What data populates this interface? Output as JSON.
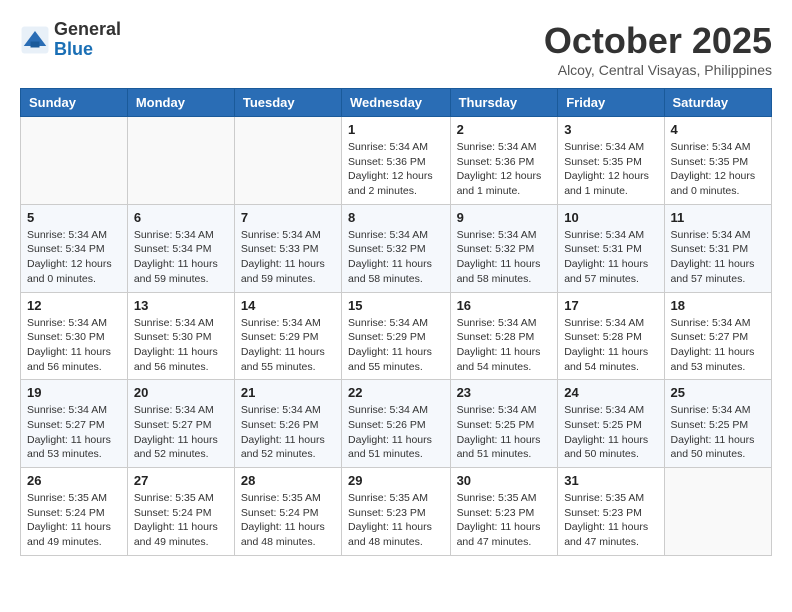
{
  "header": {
    "logo_line1": "General",
    "logo_line2": "Blue",
    "month": "October 2025",
    "location": "Alcoy, Central Visayas, Philippines"
  },
  "weekdays": [
    "Sunday",
    "Monday",
    "Tuesday",
    "Wednesday",
    "Thursday",
    "Friday",
    "Saturday"
  ],
  "weeks": [
    [
      {
        "day": "",
        "info": ""
      },
      {
        "day": "",
        "info": ""
      },
      {
        "day": "",
        "info": ""
      },
      {
        "day": "1",
        "info": "Sunrise: 5:34 AM\nSunset: 5:36 PM\nDaylight: 12 hours\nand 2 minutes."
      },
      {
        "day": "2",
        "info": "Sunrise: 5:34 AM\nSunset: 5:36 PM\nDaylight: 12 hours\nand 1 minute."
      },
      {
        "day": "3",
        "info": "Sunrise: 5:34 AM\nSunset: 5:35 PM\nDaylight: 12 hours\nand 1 minute."
      },
      {
        "day": "4",
        "info": "Sunrise: 5:34 AM\nSunset: 5:35 PM\nDaylight: 12 hours\nand 0 minutes."
      }
    ],
    [
      {
        "day": "5",
        "info": "Sunrise: 5:34 AM\nSunset: 5:34 PM\nDaylight: 12 hours\nand 0 minutes."
      },
      {
        "day": "6",
        "info": "Sunrise: 5:34 AM\nSunset: 5:34 PM\nDaylight: 11 hours\nand 59 minutes."
      },
      {
        "day": "7",
        "info": "Sunrise: 5:34 AM\nSunset: 5:33 PM\nDaylight: 11 hours\nand 59 minutes."
      },
      {
        "day": "8",
        "info": "Sunrise: 5:34 AM\nSunset: 5:32 PM\nDaylight: 11 hours\nand 58 minutes."
      },
      {
        "day": "9",
        "info": "Sunrise: 5:34 AM\nSunset: 5:32 PM\nDaylight: 11 hours\nand 58 minutes."
      },
      {
        "day": "10",
        "info": "Sunrise: 5:34 AM\nSunset: 5:31 PM\nDaylight: 11 hours\nand 57 minutes."
      },
      {
        "day": "11",
        "info": "Sunrise: 5:34 AM\nSunset: 5:31 PM\nDaylight: 11 hours\nand 57 minutes."
      }
    ],
    [
      {
        "day": "12",
        "info": "Sunrise: 5:34 AM\nSunset: 5:30 PM\nDaylight: 11 hours\nand 56 minutes."
      },
      {
        "day": "13",
        "info": "Sunrise: 5:34 AM\nSunset: 5:30 PM\nDaylight: 11 hours\nand 56 minutes."
      },
      {
        "day": "14",
        "info": "Sunrise: 5:34 AM\nSunset: 5:29 PM\nDaylight: 11 hours\nand 55 minutes."
      },
      {
        "day": "15",
        "info": "Sunrise: 5:34 AM\nSunset: 5:29 PM\nDaylight: 11 hours\nand 55 minutes."
      },
      {
        "day": "16",
        "info": "Sunrise: 5:34 AM\nSunset: 5:28 PM\nDaylight: 11 hours\nand 54 minutes."
      },
      {
        "day": "17",
        "info": "Sunrise: 5:34 AM\nSunset: 5:28 PM\nDaylight: 11 hours\nand 54 minutes."
      },
      {
        "day": "18",
        "info": "Sunrise: 5:34 AM\nSunset: 5:27 PM\nDaylight: 11 hours\nand 53 minutes."
      }
    ],
    [
      {
        "day": "19",
        "info": "Sunrise: 5:34 AM\nSunset: 5:27 PM\nDaylight: 11 hours\nand 53 minutes."
      },
      {
        "day": "20",
        "info": "Sunrise: 5:34 AM\nSunset: 5:27 PM\nDaylight: 11 hours\nand 52 minutes."
      },
      {
        "day": "21",
        "info": "Sunrise: 5:34 AM\nSunset: 5:26 PM\nDaylight: 11 hours\nand 52 minutes."
      },
      {
        "day": "22",
        "info": "Sunrise: 5:34 AM\nSunset: 5:26 PM\nDaylight: 11 hours\nand 51 minutes."
      },
      {
        "day": "23",
        "info": "Sunrise: 5:34 AM\nSunset: 5:25 PM\nDaylight: 11 hours\nand 51 minutes."
      },
      {
        "day": "24",
        "info": "Sunrise: 5:34 AM\nSunset: 5:25 PM\nDaylight: 11 hours\nand 50 minutes."
      },
      {
        "day": "25",
        "info": "Sunrise: 5:34 AM\nSunset: 5:25 PM\nDaylight: 11 hours\nand 50 minutes."
      }
    ],
    [
      {
        "day": "26",
        "info": "Sunrise: 5:35 AM\nSunset: 5:24 PM\nDaylight: 11 hours\nand 49 minutes."
      },
      {
        "day": "27",
        "info": "Sunrise: 5:35 AM\nSunset: 5:24 PM\nDaylight: 11 hours\nand 49 minutes."
      },
      {
        "day": "28",
        "info": "Sunrise: 5:35 AM\nSunset: 5:24 PM\nDaylight: 11 hours\nand 48 minutes."
      },
      {
        "day": "29",
        "info": "Sunrise: 5:35 AM\nSunset: 5:23 PM\nDaylight: 11 hours\nand 48 minutes."
      },
      {
        "day": "30",
        "info": "Sunrise: 5:35 AM\nSunset: 5:23 PM\nDaylight: 11 hours\nand 47 minutes."
      },
      {
        "day": "31",
        "info": "Sunrise: 5:35 AM\nSunset: 5:23 PM\nDaylight: 11 hours\nand 47 minutes."
      },
      {
        "day": "",
        "info": ""
      }
    ]
  ]
}
